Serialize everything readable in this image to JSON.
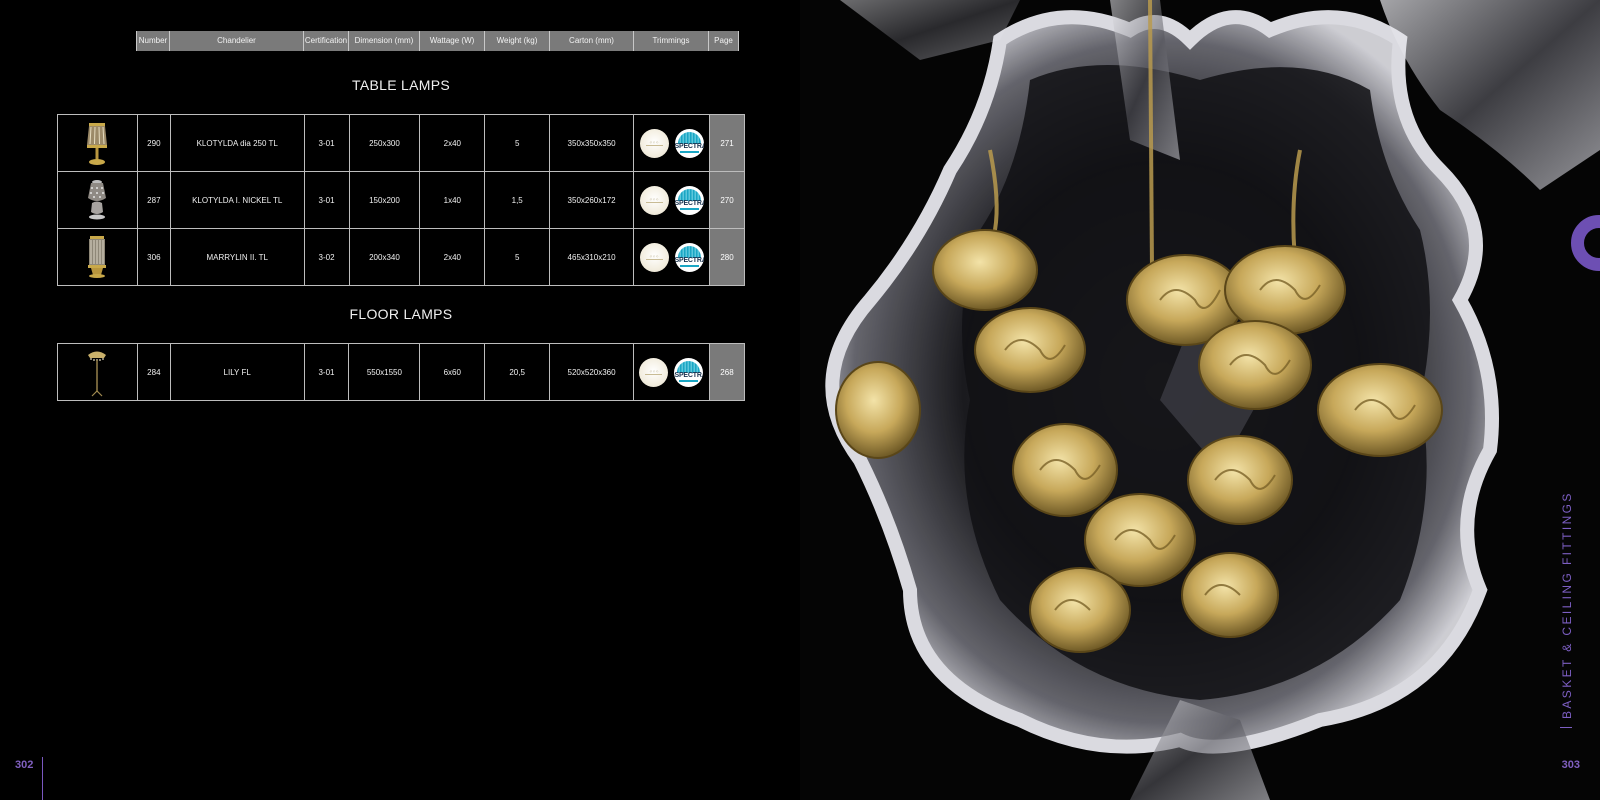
{
  "header": {
    "columns": [
      "Number",
      "Chandelier",
      "Certification",
      "Dimension (mm)",
      "Wattage (W)",
      "Weight (kg)",
      "Carton (mm)",
      "Trimmings",
      "Page"
    ]
  },
  "sections": [
    {
      "title": "TABLE LAMPS",
      "rows": [
        {
          "number": "290",
          "name": "KLOTYLDA dia 250 TL",
          "cert": "3-01",
          "dim": "250x300",
          "watt": "2x40",
          "weight": "5",
          "carton": "350x350x350",
          "page": "271"
        },
        {
          "number": "287",
          "name": "KLOTYLDA I. NICKEL TL",
          "cert": "3-01",
          "dim": "150x200",
          "watt": "1x40",
          "weight": "1,5",
          "carton": "350x260x172",
          "page": "270"
        },
        {
          "number": "306",
          "name": "MARRYLIN II. TL",
          "cert": "3-02",
          "dim": "200x340",
          "watt": "2x40",
          "weight": "5",
          "carton": "465x310x210",
          "page": "280"
        }
      ]
    },
    {
      "title": "FLOOR LAMPS",
      "rows": [
        {
          "number": "284",
          "name": "LILY FL",
          "cert": "3-01",
          "dim": "550x1550",
          "watt": "6x60",
          "weight": "20,5",
          "carton": "520x520x360",
          "page": "268"
        }
      ]
    }
  ],
  "trimmings": {
    "badge_a": "cream-crystal-badge",
    "badge_b": "SPECTRA"
  },
  "footer": {
    "left_page": "302",
    "right_page": "303",
    "side_caption": "BASKET & CEILING FITTINGS"
  },
  "colors": {
    "accent": "#7d5fc4",
    "header_bg": "#7a7a7a",
    "background": "#000000"
  }
}
